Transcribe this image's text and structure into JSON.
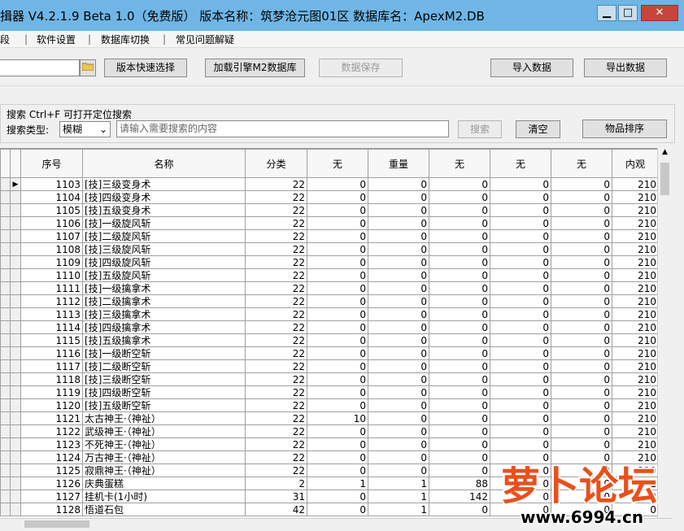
{
  "title": "揖器 V4.2.1.9   Beta 1.0（免费版）   版本名称：筑梦沧元图01区     数据库名：ApexM2.DB",
  "window_buttons": {
    "minimize": "▁",
    "maximize": "□",
    "close": "✕"
  },
  "menu": [
    "字段",
    "软件设置",
    "数据库切换",
    "常见问题解疑"
  ],
  "toolbar": {
    "version_select": "版本快速选择",
    "load_engine": "加载引擎M2数据库",
    "save_data": "数据保存",
    "import_data": "导入数据",
    "export_data": "导出数据"
  },
  "search": {
    "hint": "搜索   Ctrl+F 可打开定位搜索",
    "type_label": "搜索类型:",
    "type_value": "模糊",
    "placeholder": "请输入需要搜索的内容",
    "search_button": "搜索",
    "clear_button": "清空",
    "sort_button": "物品排序"
  },
  "table": {
    "columns": [
      "序号",
      "名称",
      "分类",
      "无",
      "重量",
      "无",
      "无",
      "无",
      "内观"
    ],
    "rows": [
      [
        "1103",
        "[技]三级变身术",
        "22",
        "0",
        "0",
        "0",
        "0",
        "0",
        "210"
      ],
      [
        "1104",
        "[技]四级变身术",
        "22",
        "0",
        "0",
        "0",
        "0",
        "0",
        "210"
      ],
      [
        "1105",
        "[技]五级变身术",
        "22",
        "0",
        "0",
        "0",
        "0",
        "0",
        "210"
      ],
      [
        "1106",
        "[技]一级旋风斩",
        "22",
        "0",
        "0",
        "0",
        "0",
        "0",
        "210"
      ],
      [
        "1107",
        "[技]二级旋风斩",
        "22",
        "0",
        "0",
        "0",
        "0",
        "0",
        "210"
      ],
      [
        "1108",
        "[技]三级旋风斩",
        "22",
        "0",
        "0",
        "0",
        "0",
        "0",
        "210"
      ],
      [
        "1109",
        "[技]四级旋风斩",
        "22",
        "0",
        "0",
        "0",
        "0",
        "0",
        "210"
      ],
      [
        "1110",
        "[技]五级旋风斩",
        "22",
        "0",
        "0",
        "0",
        "0",
        "0",
        "210"
      ],
      [
        "1111",
        "[技]一级擒拿术",
        "22",
        "0",
        "0",
        "0",
        "0",
        "0",
        "210"
      ],
      [
        "1112",
        "[技]二级擒拿术",
        "22",
        "0",
        "0",
        "0",
        "0",
        "0",
        "210"
      ],
      [
        "1113",
        "[技]三级擒拿术",
        "22",
        "0",
        "0",
        "0",
        "0",
        "0",
        "210"
      ],
      [
        "1114",
        "[技]四级擒拿术",
        "22",
        "0",
        "0",
        "0",
        "0",
        "0",
        "210"
      ],
      [
        "1115",
        "[技]五级擒拿术",
        "22",
        "0",
        "0",
        "0",
        "0",
        "0",
        "210"
      ],
      [
        "1116",
        "[技]一级断空斩",
        "22",
        "0",
        "0",
        "0",
        "0",
        "0",
        "210"
      ],
      [
        "1117",
        "[技]二级断空斩",
        "22",
        "0",
        "0",
        "0",
        "0",
        "0",
        "210"
      ],
      [
        "1118",
        "[技]三级断空斩",
        "22",
        "0",
        "0",
        "0",
        "0",
        "0",
        "210"
      ],
      [
        "1119",
        "[技]四级断空斩",
        "22",
        "0",
        "0",
        "0",
        "0",
        "0",
        "210"
      ],
      [
        "1120",
        "[技]五级断空斩",
        "22",
        "0",
        "0",
        "0",
        "0",
        "0",
        "210"
      ],
      [
        "1121",
        "太古神王·（神祉）",
        "22",
        "10",
        "0",
        "0",
        "0",
        "0",
        "210"
      ],
      [
        "1122",
        "武级神王·（神祉）",
        "22",
        "0",
        "0",
        "0",
        "0",
        "0",
        "210"
      ],
      [
        "1123",
        "不死神王·（神祉）",
        "22",
        "0",
        "0",
        "0",
        "0",
        "0",
        "210"
      ],
      [
        "1124",
        "万古神王·（神祉）",
        "22",
        "0",
        "0",
        "0",
        "0",
        "0",
        "210"
      ],
      [
        "1125",
        "寂鼎神王·（神祉）",
        "22",
        "0",
        "0",
        "0",
        "0",
        "0",
        "210"
      ],
      [
        "1126",
        "庆典蛋糕",
        "2",
        "1",
        "1",
        "88",
        "0",
        "0",
        "1"
      ],
      [
        "1127",
        "挂机卡(1小时)",
        "31",
        "0",
        "1",
        "142",
        "0",
        "0",
        "0"
      ],
      [
        "1128",
        "悟道石包",
        "42",
        "0",
        "1",
        "0",
        "0",
        "0",
        "0"
      ]
    ]
  },
  "watermark": {
    "brand": "萝卜论坛",
    "url": "www.6994.cn"
  }
}
